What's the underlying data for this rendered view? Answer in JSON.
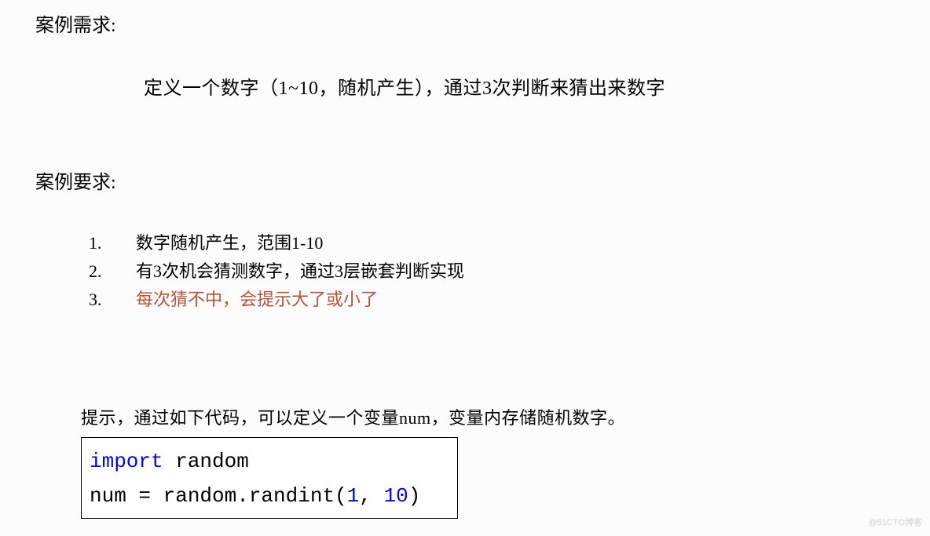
{
  "section1": {
    "heading": "案例需求:",
    "desc": "定义一个数字（1~10，随机产生），通过3次判断来猜出来数字"
  },
  "section2": {
    "heading": "案例要求:",
    "items": [
      {
        "num": "1.",
        "text": "数字随机产生，范围1-10",
        "highlight": false
      },
      {
        "num": "2.",
        "text": "有3次机会猜测数字，通过3层嵌套判断实现",
        "highlight": false
      },
      {
        "num": "3.",
        "text": "每次猜不中，会提示大了或小了",
        "highlight": true
      }
    ]
  },
  "hint": {
    "text": "提示，通过如下代码，可以定义一个变量num，变量内存储随机数字。",
    "code": {
      "line1_kw": "import",
      "line1_rest": " random",
      "line2_pre": "num = random.randint(",
      "line2_n1": "1",
      "line2_mid": ", ",
      "line2_n2": "10",
      "line2_post": ")"
    }
  },
  "watermark": "@51CTO博客"
}
